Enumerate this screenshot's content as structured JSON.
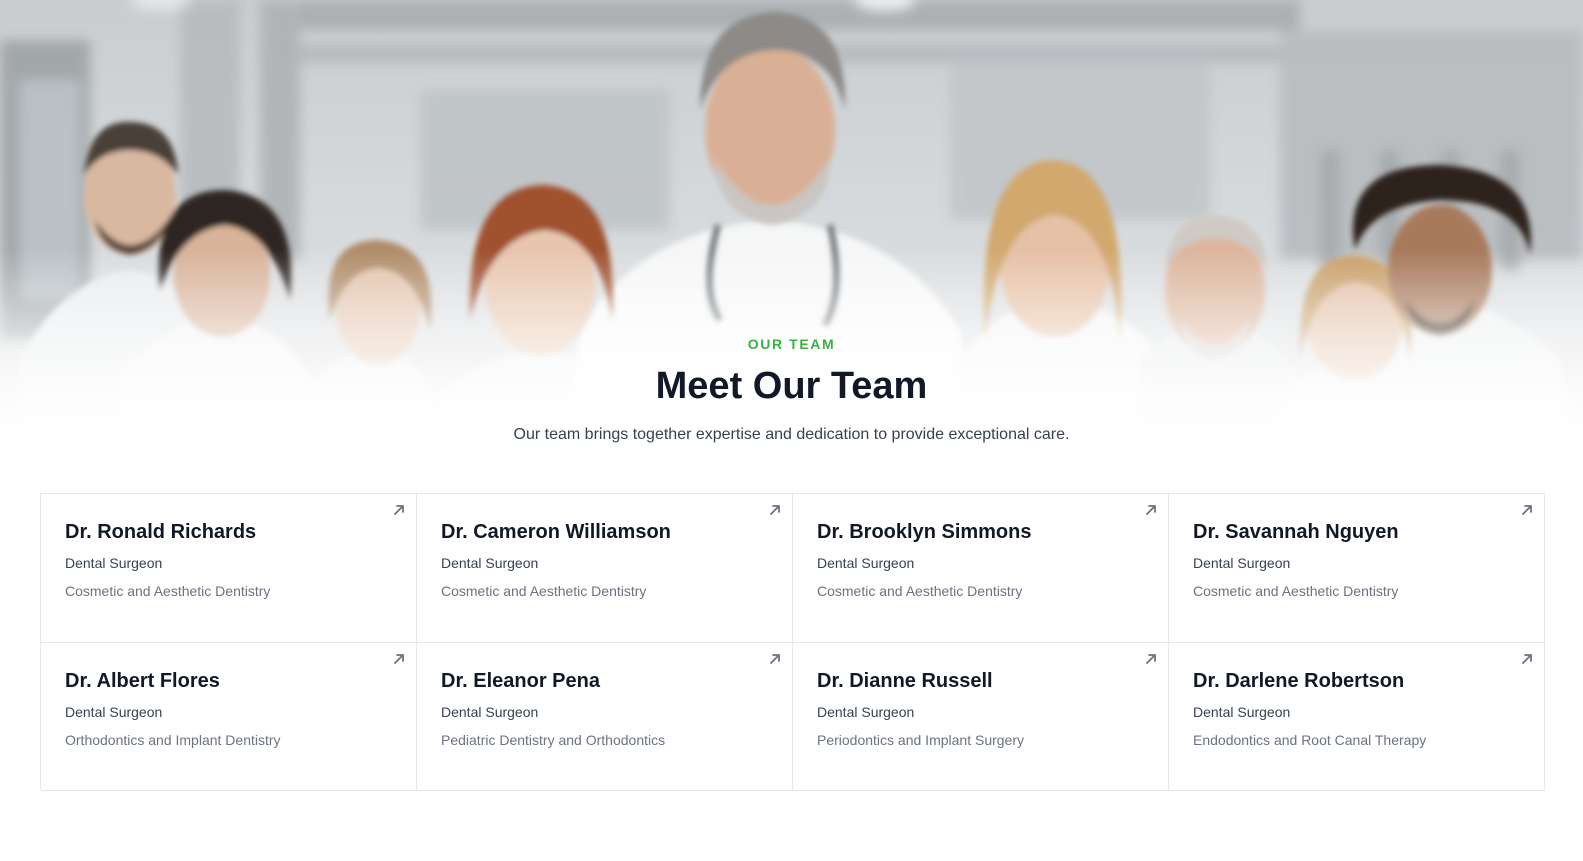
{
  "hero": {
    "eyebrow": "OUR TEAM",
    "title": "Meet Our Team",
    "subtitle": "Our team brings together expertise and dedication to provide exceptional care."
  },
  "colors": {
    "accent_green": "#3bb143",
    "heading": "#111827",
    "body_text": "#374151",
    "muted_text": "#6b7280",
    "border": "#e5e7eb"
  },
  "team": [
    {
      "name": "Dr. Ronald Richards",
      "role": "Dental Surgeon",
      "specialty": "Cosmetic and Aesthetic Dentistry",
      "icon": "arrow-up-right-icon"
    },
    {
      "name": "Dr. Cameron Williamson",
      "role": "Dental Surgeon",
      "specialty": "Cosmetic and Aesthetic Dentistry",
      "icon": "arrow-up-right-icon"
    },
    {
      "name": "Dr. Brooklyn Simmons",
      "role": "Dental Surgeon",
      "specialty": "Cosmetic and Aesthetic Dentistry",
      "icon": "arrow-up-right-icon"
    },
    {
      "name": "Dr. Savannah Nguyen",
      "role": "Dental Surgeon",
      "specialty": "Cosmetic and Aesthetic Dentistry",
      "icon": "arrow-up-right-icon"
    },
    {
      "name": "Dr. Albert Flores",
      "role": "Dental Surgeon",
      "specialty": "Orthodontics and Implant Dentistry",
      "icon": "arrow-up-right-icon"
    },
    {
      "name": "Dr. Eleanor Pena",
      "role": "Dental Surgeon",
      "specialty": "Pediatric Dentistry and Orthodontics",
      "icon": "arrow-up-right-icon"
    },
    {
      "name": "Dr. Dianne Russell",
      "role": "Dental Surgeon",
      "specialty": "Periodontics and Implant Surgery",
      "icon": "arrow-up-right-icon"
    },
    {
      "name": "Dr. Darlene Robertson",
      "role": "Dental Surgeon",
      "specialty": "Endodontics and Root Canal Therapy",
      "icon": "arrow-up-right-icon"
    }
  ]
}
